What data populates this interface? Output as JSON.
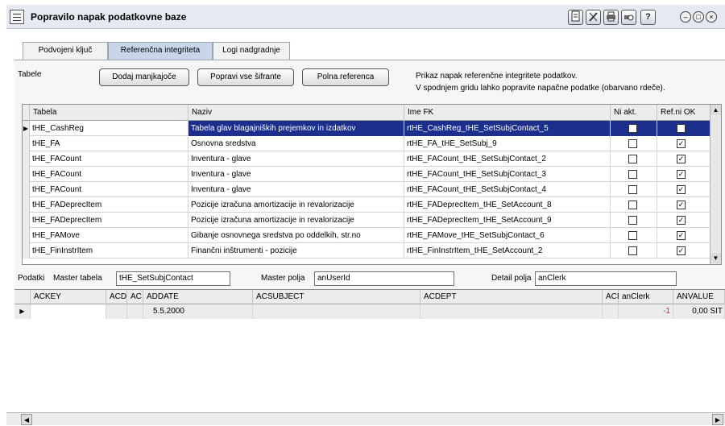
{
  "window": {
    "title": "Popravilo napak podatkovne baze",
    "toolbar_icons": [
      "document-icon",
      "tools-icon",
      "print-icon",
      "print-preview-icon",
      "help-icon"
    ],
    "help_label": "?"
  },
  "tabs": [
    {
      "label": "Podvojeni ključ",
      "active": false
    },
    {
      "label": "Referenčna integriteta",
      "active": true
    },
    {
      "label": "Logi nadgradnje",
      "active": false
    }
  ],
  "toolbar": {
    "tables_label": "Tabele",
    "add_missing": "Dodaj manjkajoče",
    "fix_all": "Popravi vse šifrante",
    "full_reference": "Polna referenca",
    "info_line1": "Prikaz napak referenčne integritete podatkov.",
    "info_line2": "V spodnjem gridu lahko popravite napačne podatke (obarvano rdeče)."
  },
  "grid1": {
    "columns": [
      "Tabela",
      "Naziv",
      "Ime FK",
      "Ni akt.",
      "Ref.ni OK"
    ],
    "rows": [
      {
        "tabela": "tHE_CashReg",
        "naziv": "Tabela glav blagajniških prejemkov in izdatkov",
        "fk": "rtHE_CashReg_tHE_SetSubjContact_5",
        "ni_akt": false,
        "ref_ok": true,
        "selected": true
      },
      {
        "tabela": "tHE_FA",
        "naziv": "Osnovna sredstva",
        "fk": "rtHE_FA_tHE_SetSubj_9",
        "ni_akt": false,
        "ref_ok": true,
        "selected": false
      },
      {
        "tabela": "tHE_FACount",
        "naziv": "Inventura - glave",
        "fk": "rtHE_FACount_tHE_SetSubjContact_2",
        "ni_akt": false,
        "ref_ok": true,
        "selected": false
      },
      {
        "tabela": "tHE_FACount",
        "naziv": "Inventura - glave",
        "fk": "rtHE_FACount_tHE_SetSubjContact_3",
        "ni_akt": false,
        "ref_ok": true,
        "selected": false
      },
      {
        "tabela": "tHE_FACount",
        "naziv": "Inventura - glave",
        "fk": "rtHE_FACount_tHE_SetSubjContact_4",
        "ni_akt": false,
        "ref_ok": true,
        "selected": false
      },
      {
        "tabela": "tHE_FADeprecItem",
        "naziv": "Pozicije izračuna amortizacije in revalorizacije",
        "fk": "rtHE_FADeprecItem_tHE_SetAccount_8",
        "ni_akt": false,
        "ref_ok": true,
        "selected": false
      },
      {
        "tabela": "tHE_FADeprecItem",
        "naziv": "Pozicije izračuna amortizacije in revalorizacije",
        "fk": "rtHE_FADeprecItem_tHE_SetAccount_9",
        "ni_akt": false,
        "ref_ok": true,
        "selected": false
      },
      {
        "tabela": "tHE_FAMove",
        "naziv": "Gibanje osnovnega sredstva po oddelkih, str.no",
        "fk": "rtHE_FAMove_tHE_SetSubjContact_6",
        "ni_akt": false,
        "ref_ok": true,
        "selected": false
      },
      {
        "tabela": "tHE_FinInstrItem",
        "naziv": "Finančni inštrumenti - pozicije",
        "fk": "rtHE_FinInstrItem_tHE_SetAccount_2",
        "ni_akt": false,
        "ref_ok": true,
        "selected": false
      }
    ]
  },
  "detail": {
    "data_label": "Podatki",
    "master_table_label": "Master tabela",
    "master_table_value": "tHE_SetSubjContact",
    "master_field_label": "Master polja",
    "master_field_value": "anUserId",
    "detail_field_label": "Detail polja",
    "detail_field_value": "anClerk"
  },
  "grid2": {
    "columns": [
      "ACKEY",
      "ACD",
      "AC",
      "ADDATE",
      "ACSUBJECT",
      "ACDEPT",
      "ACI",
      "anClerk",
      "ANVALUE"
    ],
    "row": {
      "ackey": "",
      "acd": "",
      "ac": "",
      "addate": "5.5.2000",
      "acsubject": "",
      "acdept": "",
      "aci": "",
      "anclerk": "-1",
      "anvalue": "0,00 SIT"
    },
    "error_color": "#e02020"
  },
  "colors": {
    "selection": "#1c2f8c",
    "active_tab": "#c9d6ea",
    "titlebar": "#e4e9f2"
  }
}
